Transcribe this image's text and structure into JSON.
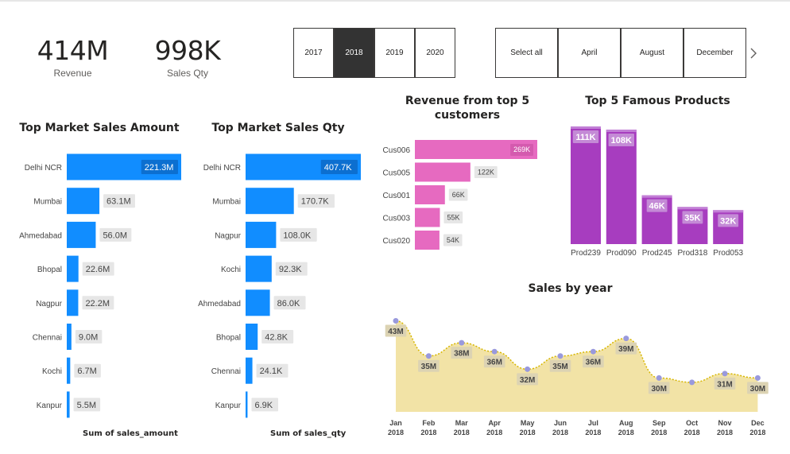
{
  "kpis": [
    {
      "value": "414M",
      "label": "Revenue"
    },
    {
      "value": "998K",
      "label": "Sales Qty"
    }
  ],
  "year_slicer": {
    "items": [
      "2017",
      "2018",
      "2019",
      "2020"
    ],
    "selected": "2018"
  },
  "month_slicer": {
    "items": [
      "Select all",
      "April",
      "August",
      "December"
    ]
  },
  "colors": {
    "market_bar": "#118dff",
    "customer_bar": "#e66ac0",
    "product_bar": "#a73dbf",
    "area_fill": "#f2e3a6",
    "area_line": "#d7b600",
    "point": "#9999dd",
    "label_bg": "#e6e6e6",
    "slicer_selected": "#333333"
  },
  "titles": {
    "market_amount": "Top Market Sales Amount",
    "market_qty": "Top Market Sales Qty",
    "customers": "Revenue from top 5 customers",
    "products": "Top 5 Famous Products",
    "sales_year": "Sales by year"
  },
  "footers": {
    "market_amount": "Sum of sales_amount",
    "market_qty": "Sum of sales_qty"
  },
  "chart_data": [
    {
      "id": "market_amount",
      "type": "bar",
      "orientation": "horizontal",
      "title": "Top Market Sales Amount",
      "xlabel": "Sum of sales_amount",
      "categories": [
        "Delhi NCR",
        "Mumbai",
        "Ahmedabad",
        "Bhopal",
        "Nagpur",
        "Chennai",
        "Kochi",
        "Kanpur"
      ],
      "values": [
        221.3,
        63.1,
        56.0,
        22.6,
        22.2,
        9.0,
        6.7,
        5.5
      ],
      "labels": [
        "221.3M",
        "63.1M",
        "56.0M",
        "22.6M",
        "22.2M",
        "9.0M",
        "6.7M",
        "5.5M"
      ],
      "max": 221.3
    },
    {
      "id": "market_qty",
      "type": "bar",
      "orientation": "horizontal",
      "title": "Top Market Sales Qty",
      "xlabel": "Sum of sales_qty",
      "categories": [
        "Delhi NCR",
        "Mumbai",
        "Nagpur",
        "Kochi",
        "Ahmedabad",
        "Bhopal",
        "Chennai",
        "Kanpur"
      ],
      "values": [
        407.7,
        170.7,
        108.0,
        92.3,
        86.0,
        42.8,
        24.1,
        6.9
      ],
      "labels": [
        "407.7K",
        "170.7K",
        "108.0K",
        "92.3K",
        "86.0K",
        "42.8K",
        "24.1K",
        "6.9K"
      ],
      "max": 407.7
    },
    {
      "id": "customers",
      "type": "bar",
      "orientation": "horizontal",
      "title": "Revenue from top 5 customers",
      "categories": [
        "Cus006",
        "Cus005",
        "Cus001",
        "Cus003",
        "Cus020"
      ],
      "values": [
        269,
        122,
        66,
        55,
        54
      ],
      "labels": [
        "269K",
        "122K",
        "66K",
        "55K",
        "54K"
      ],
      "max": 269
    },
    {
      "id": "products",
      "type": "bar",
      "orientation": "vertical",
      "title": "Top 5 Famous Products",
      "categories": [
        "Prod239",
        "Prod090",
        "Prod245",
        "Prod318",
        "Prod053"
      ],
      "values": [
        111,
        108,
        46,
        35,
        32
      ],
      "labels": [
        "111K",
        "108K",
        "46K",
        "35K",
        "32K"
      ],
      "max": 111
    },
    {
      "id": "sales_year",
      "type": "area",
      "title": "Sales by year",
      "categories": [
        "Jan",
        "Feb",
        "Mar",
        "Apr",
        "May",
        "Jun",
        "Jul",
        "Aug",
        "Sep",
        "Oct",
        "Nov",
        "Dec"
      ],
      "category_sublabel": "2018",
      "values": [
        43,
        35,
        38,
        36,
        32,
        35,
        36,
        39,
        30,
        29,
        31,
        30
      ],
      "labels": [
        "43M",
        "35M",
        "38M",
        "36M",
        "32M",
        "35M",
        "36M",
        "39M",
        "30M",
        "",
        "31M",
        "30M"
      ],
      "ylim": [
        25,
        44
      ]
    }
  ]
}
